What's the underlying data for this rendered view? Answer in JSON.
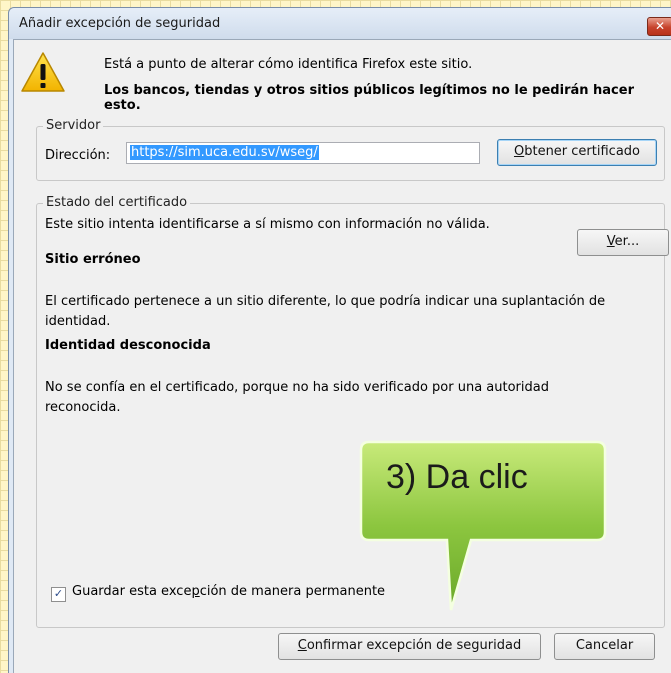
{
  "window": {
    "title": "Añadir excepción de seguridad",
    "close_glyph": "✕"
  },
  "intro": {
    "line1": "Está a punto de alterar cómo identifica Firefox este sitio.",
    "line2": "Los bancos, tiendas y otros sitios públicos legítimos no le pedirán hacer esto."
  },
  "server": {
    "legend": "Servidor",
    "address_label": "Dirección:",
    "address_value": "https://sim.uca.edu.sv/wseg/",
    "get_cert_underline": "O",
    "get_cert_rest": "btener certificado"
  },
  "status": {
    "legend": "Estado del certificado",
    "summary": "Este sitio intenta identificarse a sí mismo con información no válida.",
    "view_underline": "V",
    "view_rest": "er...",
    "wrong_site_title": "Sitio erróneo",
    "wrong_site_desc_l1": "El certificado pertenece a un sitio diferente, lo que podría indicar una suplantación de",
    "wrong_site_desc_l2": "identidad.",
    "unknown_title": "Identidad desconocida",
    "unknown_desc_l1": "No se confía en el certificado, porque no ha sido verificado por una autoridad",
    "unknown_desc_l2": "reconocida."
  },
  "permanent": {
    "checked": true,
    "label_pre": "Guardar esta exce",
    "label_underline": "p",
    "label_post": "ción de manera permanente"
  },
  "buttons": {
    "confirm_underline": "C",
    "confirm_rest": "onfirmar excepción de seguridad",
    "cancel": "Cancelar"
  },
  "callout": {
    "text": "3) Da clic",
    "color": "#8cc63f"
  }
}
